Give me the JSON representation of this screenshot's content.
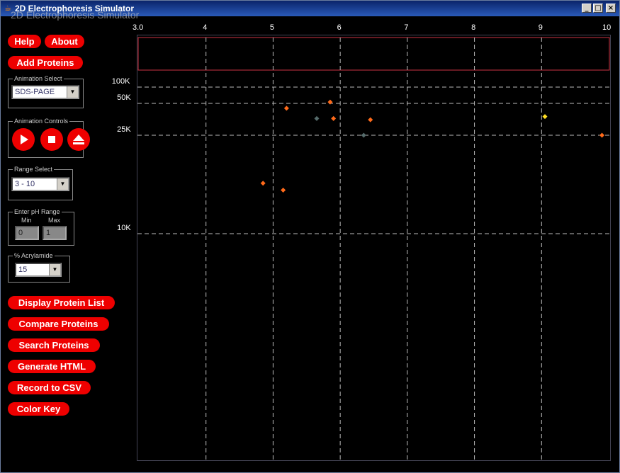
{
  "window": {
    "title": "2D Electrophoresis Simulator",
    "ghost_text": "2D Electrophoresis Simulator"
  },
  "buttons": {
    "help": "Help",
    "about": "About",
    "add_proteins": "Add Proteins",
    "display_protein_list": "Display Protein List",
    "compare_proteins": "Compare Proteins",
    "search_proteins": "Search Proteins",
    "generate_html": "Generate HTML",
    "record_to_csv": "Record to CSV",
    "color_key": "Color Key"
  },
  "animation_select": {
    "legend": "Animation Select",
    "value": "SDS-PAGE"
  },
  "animation_controls": {
    "legend": "Animation Controls",
    "icons": [
      "play-icon",
      "stop-icon",
      "eject-icon"
    ]
  },
  "range_select": {
    "legend": "Range Select",
    "value": "3 - 10"
  },
  "ph_range": {
    "legend": "Enter pH Range",
    "min_label": "Min",
    "max_label": "Max",
    "min_value": "0",
    "max_value": "1"
  },
  "acrylamide": {
    "legend": "% Acrylamide",
    "value": "15"
  },
  "colors": {
    "accent": "#ee0000",
    "title_bar": "#0a246a",
    "gel_top_border": "#cc3344",
    "grid": "#bbbbbb"
  },
  "chart_data": {
    "type": "scatter",
    "x_ticks": [
      "3.0",
      "4",
      "5",
      "6",
      "7",
      "8",
      "9",
      "10"
    ],
    "y_ticks": [
      "100K",
      "50K",
      "25K",
      "10K"
    ],
    "xlim": [
      3,
      10
    ],
    "points": [
      {
        "x": 5.2,
        "y": 45000,
        "color": "#ff6a1a"
      },
      {
        "x": 5.85,
        "y": 53000,
        "color": "#ff6a1a"
      },
      {
        "x": 5.65,
        "y": 36000,
        "color": "#556b6b"
      },
      {
        "x": 5.9,
        "y": 36000,
        "color": "#ff6a1a"
      },
      {
        "x": 6.45,
        "y": 35000,
        "color": "#ff6a1a"
      },
      {
        "x": 6.35,
        "y": 25000,
        "color": "#556b6b"
      },
      {
        "x": 9.05,
        "y": 37500,
        "color": "#ffdd22"
      },
      {
        "x": 9.9,
        "y": 25000,
        "color": "#ff6a1a"
      },
      {
        "x": 4.85,
        "y": 16000,
        "color": "#ff6a1a"
      },
      {
        "x": 5.15,
        "y": 15000,
        "color": "#ff6a1a"
      }
    ]
  }
}
